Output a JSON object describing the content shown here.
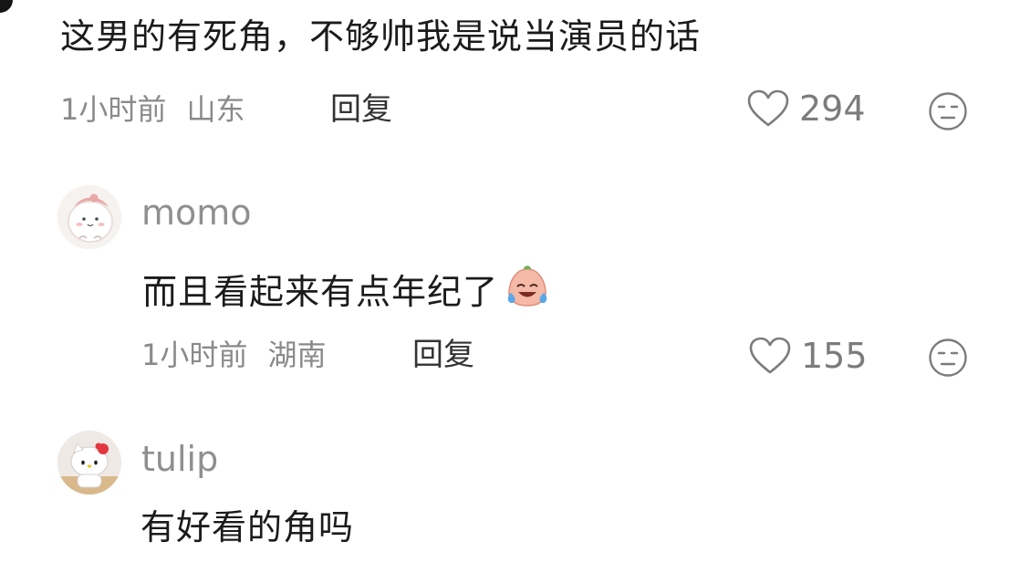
{
  "comments": [
    {
      "text": "这男的有死角，不够帅我是说当演员的话",
      "time": "1小时前",
      "location": "山东",
      "reply_label": "回复",
      "likes": "294"
    },
    {
      "username": "momo",
      "text": "而且看起来有点年纪了",
      "time": "1小时前",
      "location": "湖南",
      "reply_label": "回复",
      "likes": "155"
    },
    {
      "username": "tulip",
      "text": "有好看的角吗"
    }
  ],
  "icons": {
    "like": "heart-outline-icon",
    "dislike": "neutral-face-icon",
    "emoji": "crying-laughing-emoji"
  },
  "colors": {
    "text": "#1b1b1b",
    "meta": "#8a8a8a",
    "icon": "#7c7c7c",
    "background": "#ffffff"
  }
}
